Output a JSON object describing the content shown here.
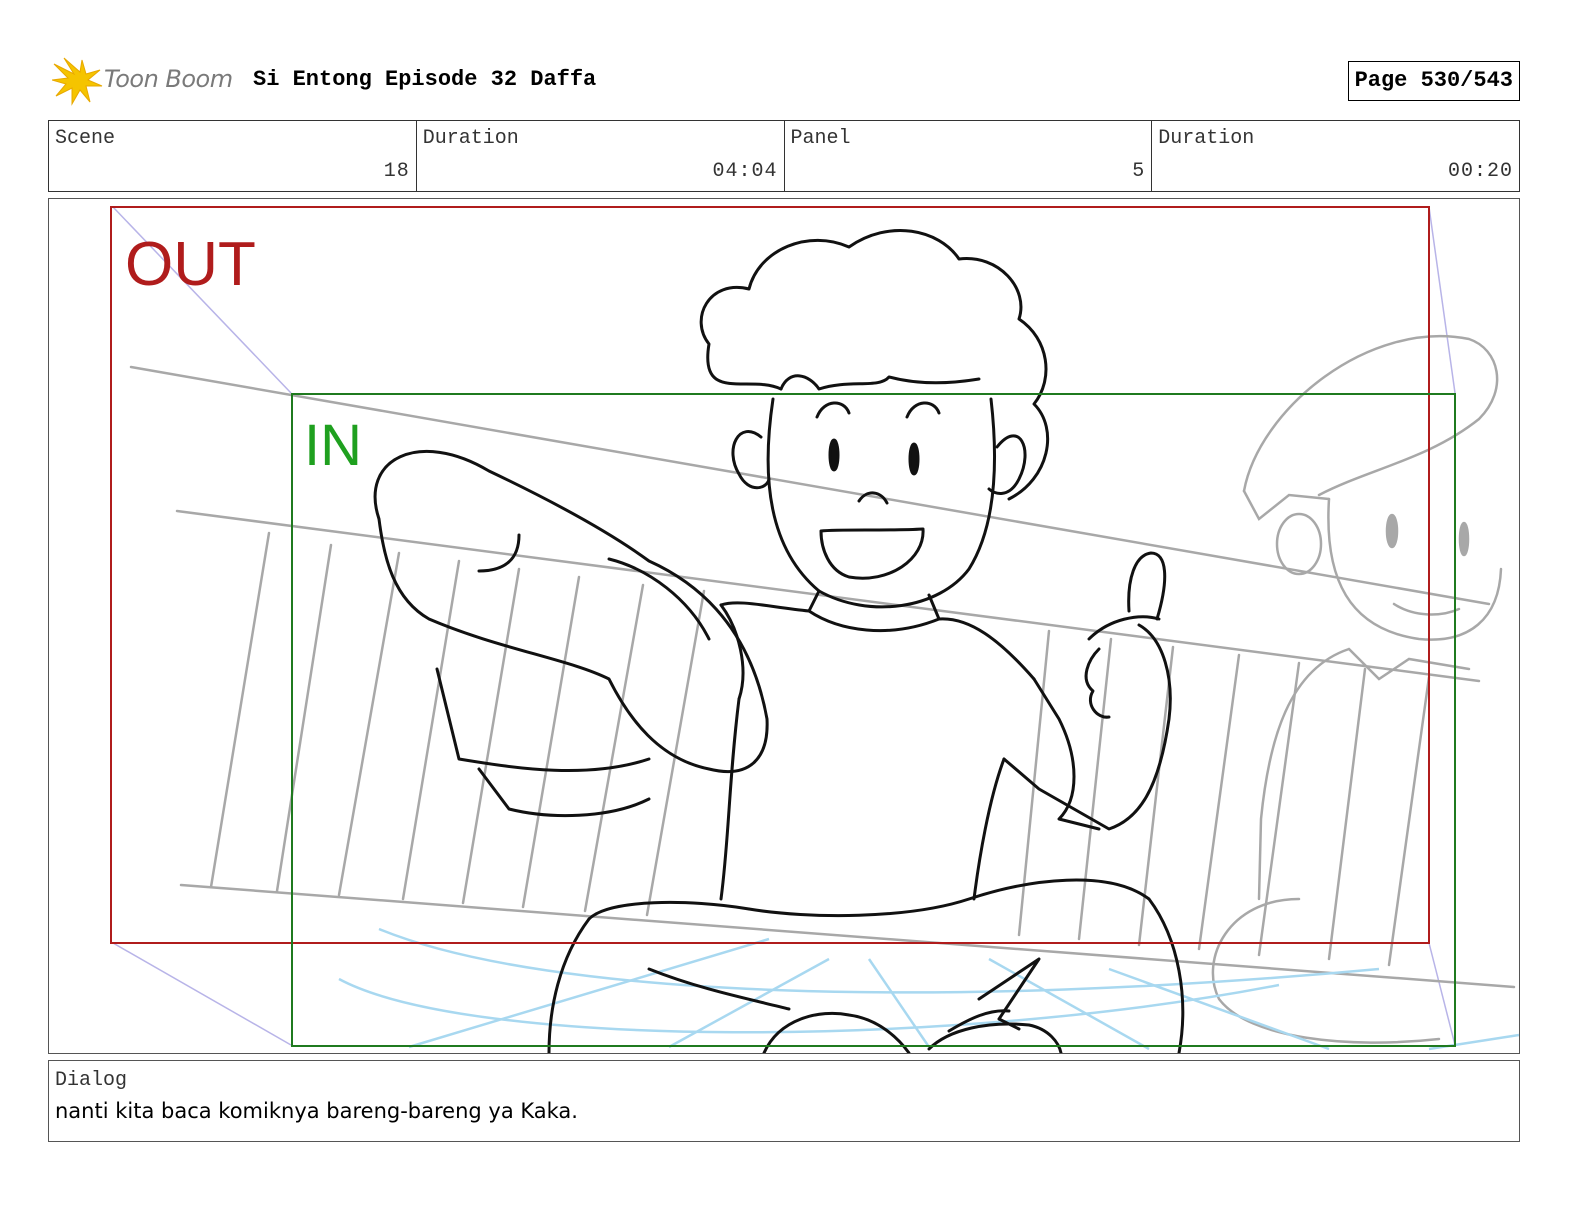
{
  "header": {
    "logo_text": "Toon Boom",
    "title": "Si Entong Episode 32 Daffa",
    "page": "Page 530/543"
  },
  "info": {
    "scene_label": "Scene",
    "scene_value": "18",
    "scene_duration_label": "Duration",
    "scene_duration_value": "04:04",
    "panel_label": "Panel",
    "panel_value": "5",
    "panel_duration_label": "Duration",
    "panel_duration_value": "00:20"
  },
  "frame": {
    "out_label": "OUT",
    "in_label": "IN",
    "out_color": "#b01c1c",
    "in_color": "#1f7a1f",
    "camera_path_color": "#b8b4e8",
    "background_sketch_color": "#a8a8a8",
    "floor_sketch_color": "#a8d8f0"
  },
  "dialog": {
    "label": "Dialog",
    "text": "nanti kita baca komiknya bareng-bareng ya Kaka."
  }
}
